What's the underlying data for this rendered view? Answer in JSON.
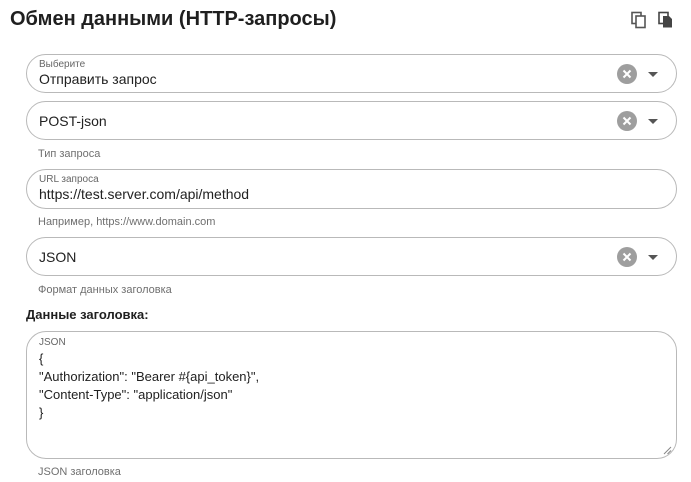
{
  "title": "Обмен данными (HTTP-запросы)",
  "icons": {
    "copy": "copy-icon",
    "paste": "paste-icon",
    "clear": "clear-icon",
    "dropdown": "chevron-down-icon"
  },
  "action_select": {
    "label": "Выберите",
    "value": "Отправить запрос"
  },
  "request_type": {
    "value": "POST-json",
    "hint": "Тип запроса"
  },
  "url": {
    "label": "URL запроса",
    "value": "https://test.server.com/api/method",
    "hint": "Например, https://www.domain.com"
  },
  "header_format": {
    "value": "JSON",
    "hint": "Формат данных заголовка"
  },
  "header_section": {
    "label": "Данные заголовка:",
    "field_label": "JSON",
    "lines": [
      "{",
      "\"Authorization\": \"Bearer #{api_token}\",",
      "\"Content-Type\": \"application/json\"",
      "}"
    ],
    "hint": "JSON заголовка"
  },
  "colors": {
    "border": "#b9b9b9",
    "clear_icon": "#9e9e9e",
    "text": "#212121",
    "hint": "#6f6f6f"
  }
}
